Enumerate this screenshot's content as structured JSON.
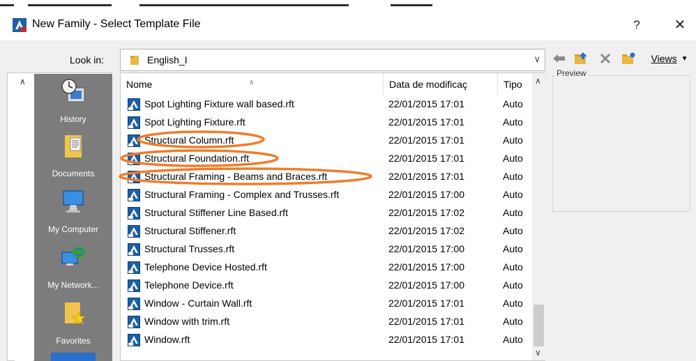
{
  "window": {
    "title": "New Family - Select Template File",
    "help_symbol": "?",
    "close_symbol": "✕"
  },
  "toolbar": {
    "look_in_label": "Look in:",
    "look_in_value": "English_I",
    "views_label": "Views",
    "icons": [
      "back-arrow-icon",
      "up-folder-icon",
      "delete-icon",
      "new-folder-icon",
      "views-dropdown-icon"
    ]
  },
  "places": [
    {
      "label": "History",
      "icon": "history-icon"
    },
    {
      "label": "Documents",
      "icon": "documents-icon"
    },
    {
      "label": "My Computer",
      "icon": "my-computer-icon"
    },
    {
      "label": "My Network...",
      "icon": "my-network-icon"
    },
    {
      "label": "Favorites",
      "icon": "favorites-icon"
    }
  ],
  "file_list": {
    "columns": [
      "Nome",
      "Data de modificaç",
      "Tipo"
    ],
    "files": [
      {
        "name": "Spot Lighting Fixture wall based.rft",
        "date": "22/01/2015 17:01",
        "type": "Auto"
      },
      {
        "name": "Spot Lighting Fixture.rft",
        "date": "22/01/2015 17:01",
        "type": "Auto"
      },
      {
        "name": "Structural Column.rft",
        "date": "22/01/2015 17:01",
        "type": "Auto"
      },
      {
        "name": "Structural Foundation.rft",
        "date": "22/01/2015 17:01",
        "type": "Auto"
      },
      {
        "name": "Structural Framing - Beams and Braces.rft",
        "date": "22/01/2015 17:01",
        "type": "Auto"
      },
      {
        "name": "Structural Framing - Complex and Trusses.rft",
        "date": "22/01/2015 17:00",
        "type": "Auto"
      },
      {
        "name": "Structural Stiffener Line Based.rft",
        "date": "22/01/2015 17:02",
        "type": "Auto"
      },
      {
        "name": "Structural Stiffener.rft",
        "date": "22/01/2015 17:02",
        "type": "Auto"
      },
      {
        "name": "Structural Trusses.rft",
        "date": "22/01/2015 17:00",
        "type": "Auto"
      },
      {
        "name": "Telephone Device Hosted.rft",
        "date": "22/01/2015 17:00",
        "type": "Auto"
      },
      {
        "name": "Telephone Device.rft",
        "date": "22/01/2015 17:00",
        "type": "Auto"
      },
      {
        "name": "Window - Curtain Wall.rft",
        "date": "22/01/2015 17:01",
        "type": "Auto"
      },
      {
        "name": "Window with trim.rft",
        "date": "22/01/2015 17:01",
        "type": "Auto"
      },
      {
        "name": "Window.rft",
        "date": "22/01/2015 17:01",
        "type": "Auto"
      }
    ]
  },
  "preview": {
    "label": "Preview"
  },
  "annotations": {
    "highlight_color": "#f07c2a",
    "highlighted_files": [
      "Structural Column.rft",
      "Structural Foundation.rft",
      "Structural Framing - Beams and Braces.rft"
    ]
  }
}
